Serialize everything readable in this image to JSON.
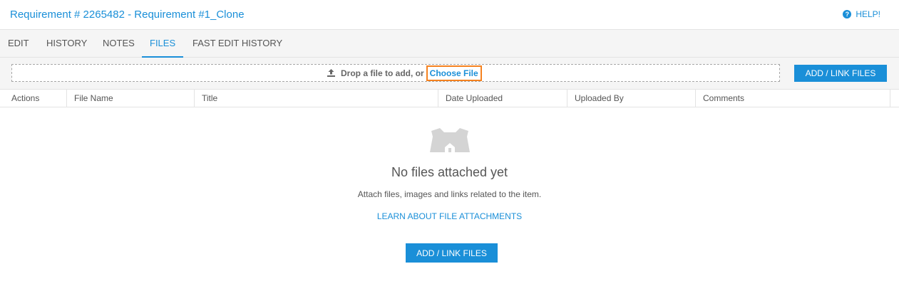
{
  "header": {
    "title": "Requirement # 2265482 - Requirement #1_Clone",
    "help_label": "HELP!",
    "help_icon": "question-circle-icon"
  },
  "tabs": [
    {
      "label": "EDIT",
      "active": false
    },
    {
      "label": "HISTORY",
      "active": false
    },
    {
      "label": "NOTES",
      "active": false
    },
    {
      "label": "FILES",
      "active": true
    },
    {
      "label": "FAST EDIT HISTORY",
      "active": false
    }
  ],
  "toolbar": {
    "drop_text": "Drop a file to add, or",
    "choose_file": "Choose File",
    "upload_icon": "upload-icon",
    "add_link_label": "ADD / LINK FILES"
  },
  "table": {
    "columns": [
      "Actions",
      "File Name",
      "Title",
      "Date Uploaded",
      "Uploaded By",
      "Comments"
    ]
  },
  "empty_state": {
    "icon": "empty-folder-icon",
    "title": "No files attached yet",
    "subtitle": "Attach files, images and links related to the item.",
    "learn_link": "LEARN ABOUT FILE ATTACHMENTS",
    "add_link_label": "ADD / LINK FILES"
  },
  "colors": {
    "accent": "#1a8fd8",
    "highlight": "#f58220",
    "tab_bg": "#f5f5f5"
  }
}
